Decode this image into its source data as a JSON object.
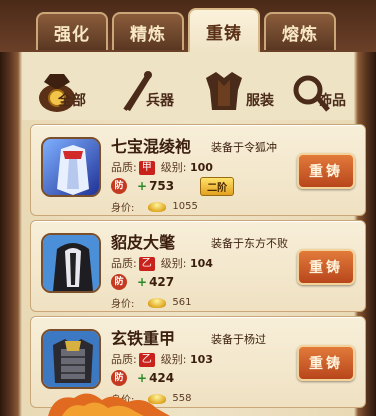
{
  "tabs": [
    {
      "label": "强化",
      "active": false
    },
    {
      "label": "精炼",
      "active": false
    },
    {
      "label": "重铸",
      "active": true
    },
    {
      "label": "熔炼",
      "active": false
    }
  ],
  "categories": [
    {
      "label": "全部",
      "icon": "bag-icon",
      "selected": true
    },
    {
      "label": "兵器",
      "icon": "weapon-icon",
      "selected": false
    },
    {
      "label": "服装",
      "icon": "armor-icon",
      "selected": false
    },
    {
      "label": "饰品",
      "icon": "ring-icon",
      "selected": false
    }
  ],
  "labels": {
    "quality": "品质:",
    "level": "级别:",
    "value": "身价:",
    "reforge_button": "重铸",
    "seal_glyph": "防",
    "quality_glyph": "乙",
    "quality_glyph_top": "甲"
  },
  "items": [
    {
      "name": "七宝混绫袍",
      "equipped": "装备于令狐冲",
      "level": "100",
      "stat": "753",
      "tier": "二阶",
      "price": "1055",
      "icon": "robe-icon"
    },
    {
      "name": "貂皮大氅",
      "equipped": "装备于东方不败",
      "level": "104",
      "stat": "427",
      "tier": "",
      "price": "561",
      "icon": "cloak-icon"
    },
    {
      "name": "玄铁重甲",
      "equipped": "装备于杨过",
      "level": "103",
      "stat": "424",
      "tier": "",
      "price": "558",
      "icon": "heavy-armor-icon"
    }
  ],
  "colors": {
    "accent": "#c8221b",
    "button": "#d0622a",
    "panel": "#efe3c6",
    "frame": "#5a3520"
  }
}
